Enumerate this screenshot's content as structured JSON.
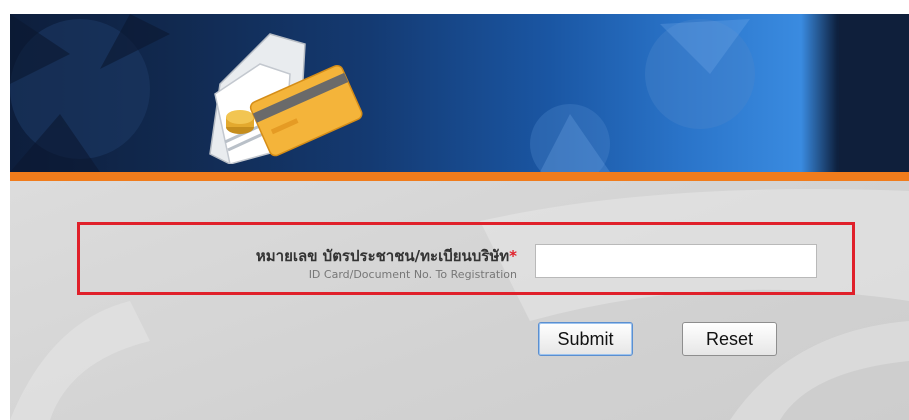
{
  "form": {
    "label_th": "หมายเลข บัตรประชาชน/ทะเบียนบริษัท",
    "required_mark": "*",
    "label_en": "ID Card/Document No. To Registration",
    "input_value": "",
    "submit_label": "Submit",
    "reset_label": "Reset"
  },
  "colors": {
    "accent_orange": "#f07c1c",
    "highlight_red": "#e0202a",
    "banner_blue": "#1a56a3"
  },
  "icons": [
    "credit-card-icon"
  ]
}
